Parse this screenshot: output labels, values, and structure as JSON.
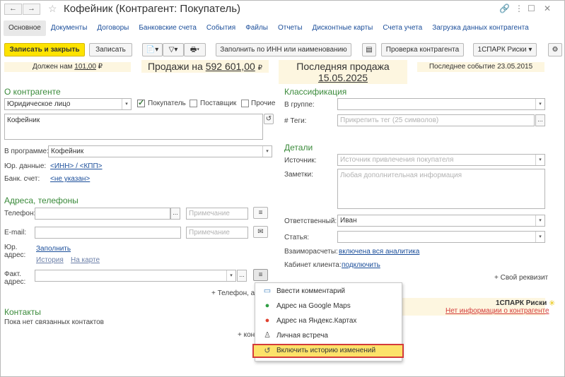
{
  "window": {
    "title": "Кофейник (Контрагент: Покупатель)",
    "back": "←",
    "forward": "→"
  },
  "tabs": [
    "Основное",
    "Документы",
    "Договоры",
    "Банковские счета",
    "События",
    "Файлы",
    "Отчеты",
    "Дисконтные карты",
    "Счета учета",
    "Загрузка данных контрагента"
  ],
  "toolbar": {
    "save_close": "Записать и закрыть",
    "save": "Записать",
    "fill_inn": "Заполнить по ИНН или наименованию",
    "check": "Проверка контрагента",
    "spark": "1СПАРК Риски"
  },
  "summary": {
    "owes_prefix": "Должен нам",
    "owes_value": "101,00",
    "currency": "₽",
    "sales_prefix": "Продажи на",
    "sales_value": "592 601,00",
    "last_sale_label": "Последняя продажа",
    "last_sale_date": "15.05.2025",
    "last_event": "Последнее событие 23.05.2015"
  },
  "about": {
    "title": "О контрагенте",
    "type": "Юридическое лицо",
    "buyer": "Покупатель",
    "supplier": "Поставщик",
    "other": "Прочие",
    "name": "Кофейник",
    "program_label": "В программе:",
    "program_value": "Кофейник",
    "legal_label": "Юр. данные:",
    "legal_link": "<ИНН> / <КПП>",
    "bank_label": "Банк. счет:",
    "bank_link": "<не указан>"
  },
  "addresses": {
    "title": "Адреса, телефоны",
    "phone_label": "Телефон:",
    "email_label": "E-mail:",
    "note_placeholder": "Примечание",
    "legal_addr_label_1": "Юр.",
    "legal_addr_label_2": "адрес:",
    "fill_link": "Заполнить",
    "history_link": "История",
    "map_link": "На карте",
    "fact_addr_label_1": "Факт.",
    "fact_addr_label_2": "адрес:",
    "add_phone": "+ Телефон, ад"
  },
  "contacts": {
    "title": "Контакты",
    "empty": "Пока нет связанных контактов",
    "add": "+ кон"
  },
  "classification": {
    "title": "Классификация",
    "group_label": "В группе:",
    "tags_label": "#  Теги:",
    "tags_placeholder": "Прикрепить тег (25 символов)"
  },
  "details": {
    "title": "Детали",
    "source_label": "Источник:",
    "source_placeholder": "Источник привлечения покупателя",
    "notes_label": "Заметки:",
    "notes_placeholder": "Любая дополнительная информация",
    "responsible_label": "Ответственный:",
    "responsible_value": "Иван",
    "article_label": "Статья:",
    "settlements_label": "Взаиморасчеты:",
    "settlements_link": "включена вся аналитика",
    "cabinet_label": "Кабинет клиента:",
    "cabinet_link": "подключить",
    "own_prop": "+ Свой реквизит",
    "spark_title": "1СПАРК Риски",
    "spark_link": "Нет информации о контрагенте"
  },
  "menu": {
    "items": [
      {
        "label": "Ввести комментарий",
        "icon": "comment-icon"
      },
      {
        "label": "Адрес на Google Maps",
        "icon": "google-maps-pin-icon"
      },
      {
        "label": "Адрес на Яндекс.Картах",
        "icon": "yandex-maps-pin-icon"
      },
      {
        "label": "Личная встреча",
        "icon": "person-icon"
      },
      {
        "label": "Включить историю изменений",
        "icon": "history-icon"
      }
    ]
  },
  "colors": {
    "primary_button": "#fde300",
    "section_title": "#3a8a3a",
    "link": "#1b4e9a",
    "highlight_border": "#d43b3b",
    "highlight_fill": "#fce26a",
    "banner": "#fdf6e0"
  }
}
